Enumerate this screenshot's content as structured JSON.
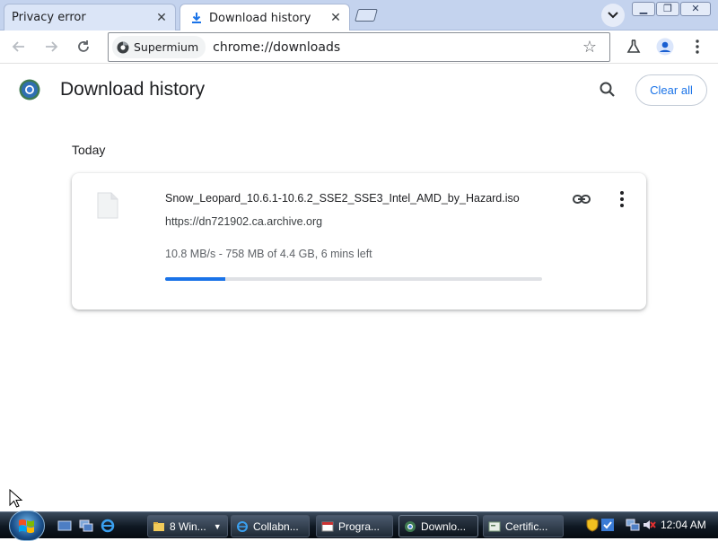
{
  "browser": {
    "tabs": [
      {
        "title": "Privacy error",
        "active": false
      },
      {
        "title": "Download history",
        "active": true
      }
    ],
    "omnibox": {
      "chip_label": "Supermium",
      "url": "chrome://downloads"
    }
  },
  "page": {
    "title": "Download history",
    "clear_all_label": "Clear all",
    "section_date": "Today",
    "downloads": [
      {
        "file_name": "Snow_Leopard_10.6.1-10.6.2_SSE2_SSE3_Intel_AMD_by_Hazard.iso",
        "source_url": "https://dn721902.ca.archive.org",
        "status": "10.8 MB/s - 758 MB of 4.4 GB, 6 mins left",
        "progress_percent": 16
      }
    ]
  },
  "taskbar": {
    "buttons": [
      {
        "label": "8 Win...",
        "icon": "folder-icon"
      },
      {
        "label": "Collabn...",
        "icon": "ie-icon"
      },
      {
        "label": "Progra...",
        "icon": "window-icon"
      },
      {
        "label": "Downlo...",
        "icon": "supermium-icon",
        "active": true
      },
      {
        "label": "Certific...",
        "icon": "certificate-icon"
      }
    ],
    "clock": "12:04 AM"
  },
  "colors": {
    "accent": "#1a73e8",
    "tabstrip": "#c4d3ee",
    "taskbar": "#0f1822"
  }
}
